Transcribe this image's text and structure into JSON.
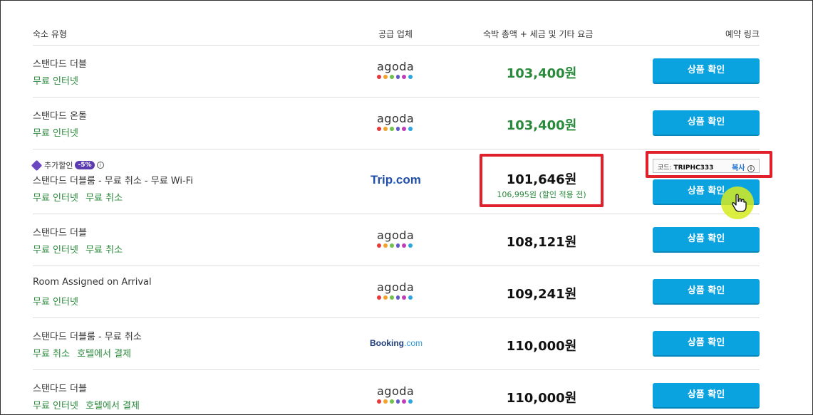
{
  "headers": {
    "room_type": "숙소 유형",
    "supplier": "공급 업체",
    "price": "숙박 총액 + 세금 및 기타 요금",
    "booking_link": "예약 링크"
  },
  "button_label": "상품 확인",
  "logos": {
    "agoda": "agoda",
    "trip_a": "Trip",
    "trip_dot": ".",
    "trip_b": "com",
    "booking_a": "Booking",
    "booking_b": ".com"
  },
  "agoda_dot_colors": [
    "#e83a3a",
    "#f2a22c",
    "#6fc14a",
    "#5f59c9",
    "#c03cb8",
    "#2da5e0"
  ],
  "promo": {
    "label": "추가할인",
    "badge": "-5%",
    "info": "i"
  },
  "coupon": {
    "code_label": "코드: ",
    "code": "TRIPHC333",
    "copy_label": "복사",
    "info": "i"
  },
  "rows": [
    {
      "room": "스탠다드 더블",
      "features": [
        "무료 인터넷"
      ],
      "supplier": "agoda",
      "price": "103,400원",
      "highlight": true
    },
    {
      "room": "스탠다드 온돌",
      "features": [
        "무료 인터넷"
      ],
      "supplier": "agoda",
      "price": "103,400원",
      "highlight": true
    },
    {
      "room": "스탠다드 더블룸 - 무료 취소 - 무료 Wi-Fi",
      "features": [
        "무료 인터넷",
        "무료 취소"
      ],
      "supplier": "trip",
      "price": "101,646원",
      "original_price": "106,995원 (할인 적용 전)",
      "highlight": false
    },
    {
      "room": "스탠다드 더블",
      "features": [
        "무료 인터넷",
        "무료 취소"
      ],
      "supplier": "agoda",
      "price": "108,121원",
      "highlight": false
    },
    {
      "room": "Room Assigned on Arrival",
      "features": [
        "무료 인터넷"
      ],
      "supplier": "agoda",
      "price": "109,241원",
      "highlight": false
    },
    {
      "room": "스탠다드 더블룸 - 무료 취소",
      "features": [
        "무료 취소",
        "호텔에서 결제"
      ],
      "supplier": "booking",
      "price": "110,000원",
      "highlight": false
    },
    {
      "room": "스탠다드 더블",
      "features": [
        "무료 인터넷",
        "호텔에서 결제"
      ],
      "supplier": "agoda",
      "price": "110,000원",
      "highlight": false
    }
  ],
  "colors": {
    "green": "#2a8a3c",
    "button": "#0aa3e0",
    "highlight_box": "#e0202a",
    "promo": "#5b3bb0",
    "cursor": "#d6eb1e"
  },
  "cursor_icon": "hand-pointer-icon"
}
